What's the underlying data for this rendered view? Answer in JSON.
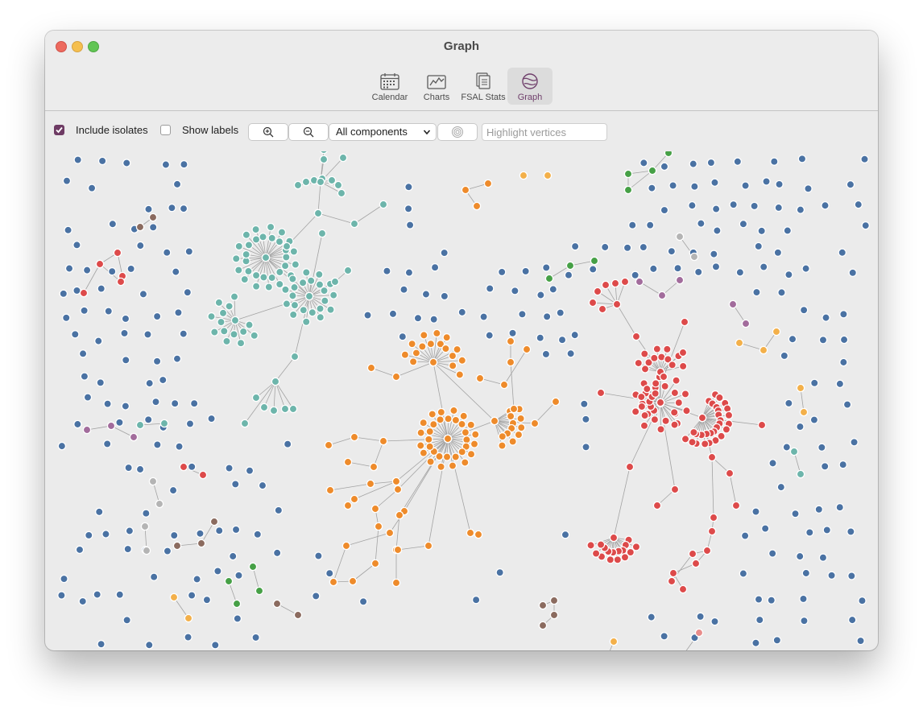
{
  "window": {
    "title": "Graph"
  },
  "tabs": [
    {
      "label": "Calendar",
      "icon": "calendar-icon"
    },
    {
      "label": "Charts",
      "icon": "line-chart-icon"
    },
    {
      "label": "FSAL Stats",
      "icon": "stacked-documents-icon"
    },
    {
      "label": "Graph",
      "icon": "graph-network-icon",
      "selected": true
    }
  ],
  "toolbar": {
    "include_isolates": {
      "label": "Include isolates",
      "checked": true
    },
    "show_labels": {
      "label": "Show labels",
      "checked": false
    },
    "zoom_in_icon": "zoom-in-icon",
    "zoom_out_icon": "zoom-out-icon",
    "components_select": {
      "value": "All components"
    },
    "center_icon": "target-icon",
    "search": {
      "placeholder": "Highlight vertices",
      "value": ""
    }
  },
  "colors": {
    "accent": "#6e3b64",
    "isolate": "#4a72a3",
    "teal": "#6db5ab",
    "orange": "#ee8b2b",
    "red": "#dd4a4a",
    "green": "#46a046",
    "brown": "#8b6b5f",
    "purple": "#a26c9c",
    "gray": "#b4b4b4",
    "light_orange": "#f3b04a",
    "pink": "#e88d8b",
    "edge": "#a3a3a3"
  }
}
